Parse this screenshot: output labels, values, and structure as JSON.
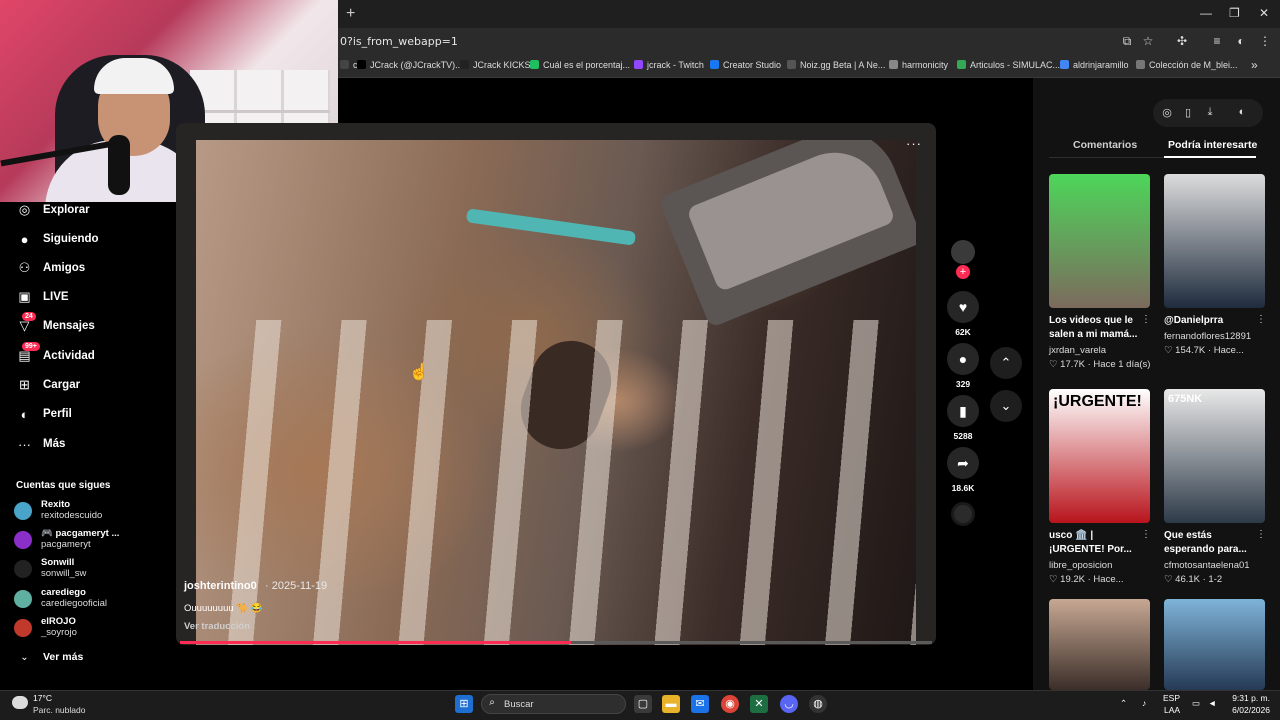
{
  "browser": {
    "url": "0?is_from_webapp=1",
    "new_tab_label": "+",
    "window_controls": [
      "—",
      "❐",
      "✕"
    ],
    "bookmarks": [
      {
        "label": "ch",
        "color": "#444"
      },
      {
        "label": "JCrack (@JCrackTV)...",
        "color": "#000"
      },
      {
        "label": "JCrack KICKS",
        "color": "#222"
      },
      {
        "label": "Cuál es el porcentaj...",
        "color": "#1fbf5f"
      },
      {
        "label": "jcrack - Twitch",
        "color": "#9146ff"
      },
      {
        "label": "Creator Studio",
        "color": "#1877f2"
      },
      {
        "label": "Noiz.gg Beta | A Ne...",
        "color": "#555"
      },
      {
        "label": "harmonicity",
        "color": "#888"
      },
      {
        "label": "Articulos - SIMULAC...",
        "color": "#34a853"
      },
      {
        "label": "aldrinjaramillo",
        "color": "#4285f4"
      },
      {
        "label": "Colección de M_blei...",
        "color": "#777"
      }
    ],
    "bookmarks_overflow": "»"
  },
  "sidebar": {
    "items": [
      {
        "label": "Explorar",
        "icon": "compass-icon",
        "glyph": "◎"
      },
      {
        "label": "Siguiendo",
        "icon": "following-icon",
        "glyph": "●"
      },
      {
        "label": "Amigos",
        "icon": "friends-icon",
        "glyph": "⚇"
      },
      {
        "label": "LIVE",
        "icon": "live-icon",
        "glyph": "▣"
      },
      {
        "label": "Mensajes",
        "icon": "messages-icon",
        "glyph": "▽",
        "badge": "24"
      },
      {
        "label": "Actividad",
        "icon": "activity-icon",
        "glyph": "▤",
        "badge": "99+"
      },
      {
        "label": "Cargar",
        "icon": "upload-icon",
        "glyph": "⊞"
      },
      {
        "label": "Perfil",
        "icon": "profile-icon",
        "glyph": "◐"
      },
      {
        "label": "Más",
        "icon": "more-icon",
        "glyph": "···"
      }
    ],
    "following_title": "Cuentas que sigues",
    "accounts": [
      {
        "name": "Rexito",
        "handle": "rexitodescuido",
        "color": "#4aa3c9"
      },
      {
        "name": "🎮 pacgameryt ...",
        "handle": "pacgameryt",
        "color": "#8b2fc9"
      },
      {
        "name": "Sonwill",
        "handle": "sonwill_sw",
        "color": "#222"
      },
      {
        "name": "carediego",
        "handle": "carediegooficial",
        "color": "#5fb0a0"
      },
      {
        "name": "elROJO",
        "handle": "_soyrojo",
        "color": "#c0392b"
      }
    ],
    "see_more": "Ver más"
  },
  "video": {
    "author": "joshterintino0",
    "date": "· 2025-11-19",
    "caption": "Ouuuuuuuu 🐪 😂",
    "translate": "Ver traducción",
    "progress": 0.52,
    "more_label": "···"
  },
  "actions": {
    "likes": "62K",
    "comments": "329",
    "saves": "5288",
    "shares": "18.6K",
    "plus_label": "+"
  },
  "right_panel": {
    "tabs": [
      "Comentarios",
      "Podría interesarte"
    ],
    "active_tab": 1,
    "tools": [
      "◎",
      "▯",
      "⤓",
      "◐"
    ],
    "videos": [
      {
        "title": "Los videos que le salen a mi mamá...",
        "user": "jxrdan_varela",
        "meta": "♡ 17.7K · Hace 1 día(s)",
        "colors": [
          "#4dd65a",
          "#7c6a5d"
        ],
        "overlay": ""
      },
      {
        "title": "@Danielprra",
        "user": "fernandoflores12891",
        "meta": "♡ 154.7K · Hace...",
        "colors": [
          "#dcdcdc",
          "#1f2c3d"
        ],
        "overlay": ""
      },
      {
        "title": "usco 🏛️ | ¡URGENTE! Por...",
        "user": "libre_oposicion",
        "meta": "♡ 19.2K · Hace...",
        "colors": [
          "#ffffff",
          "#b8141c"
        ],
        "overlay": "¡URGENTE!"
      },
      {
        "title": "Que estás esperando para...",
        "user": "cfmotosantaelena01",
        "meta": "♡ 46.1K · 1-2",
        "colors": [
          "#e8e8e8",
          "#2d3a48"
        ],
        "overlay": "675NK"
      },
      {
        "title": "",
        "user": "",
        "meta": "",
        "colors": [
          "#c7a893",
          "#3b2e29"
        ],
        "overlay": ""
      },
      {
        "title": "",
        "user": "",
        "meta": "",
        "colors": [
          "#7fb4d9",
          "#263a55"
        ],
        "overlay": ""
      }
    ]
  },
  "taskbar": {
    "temp": "17°C",
    "weather": "Parc. nublado",
    "search_placeholder": "Buscar",
    "lang": "ESP",
    "region": "LAA",
    "time": "9:31 p. m.",
    "date": "6/02/2026"
  }
}
